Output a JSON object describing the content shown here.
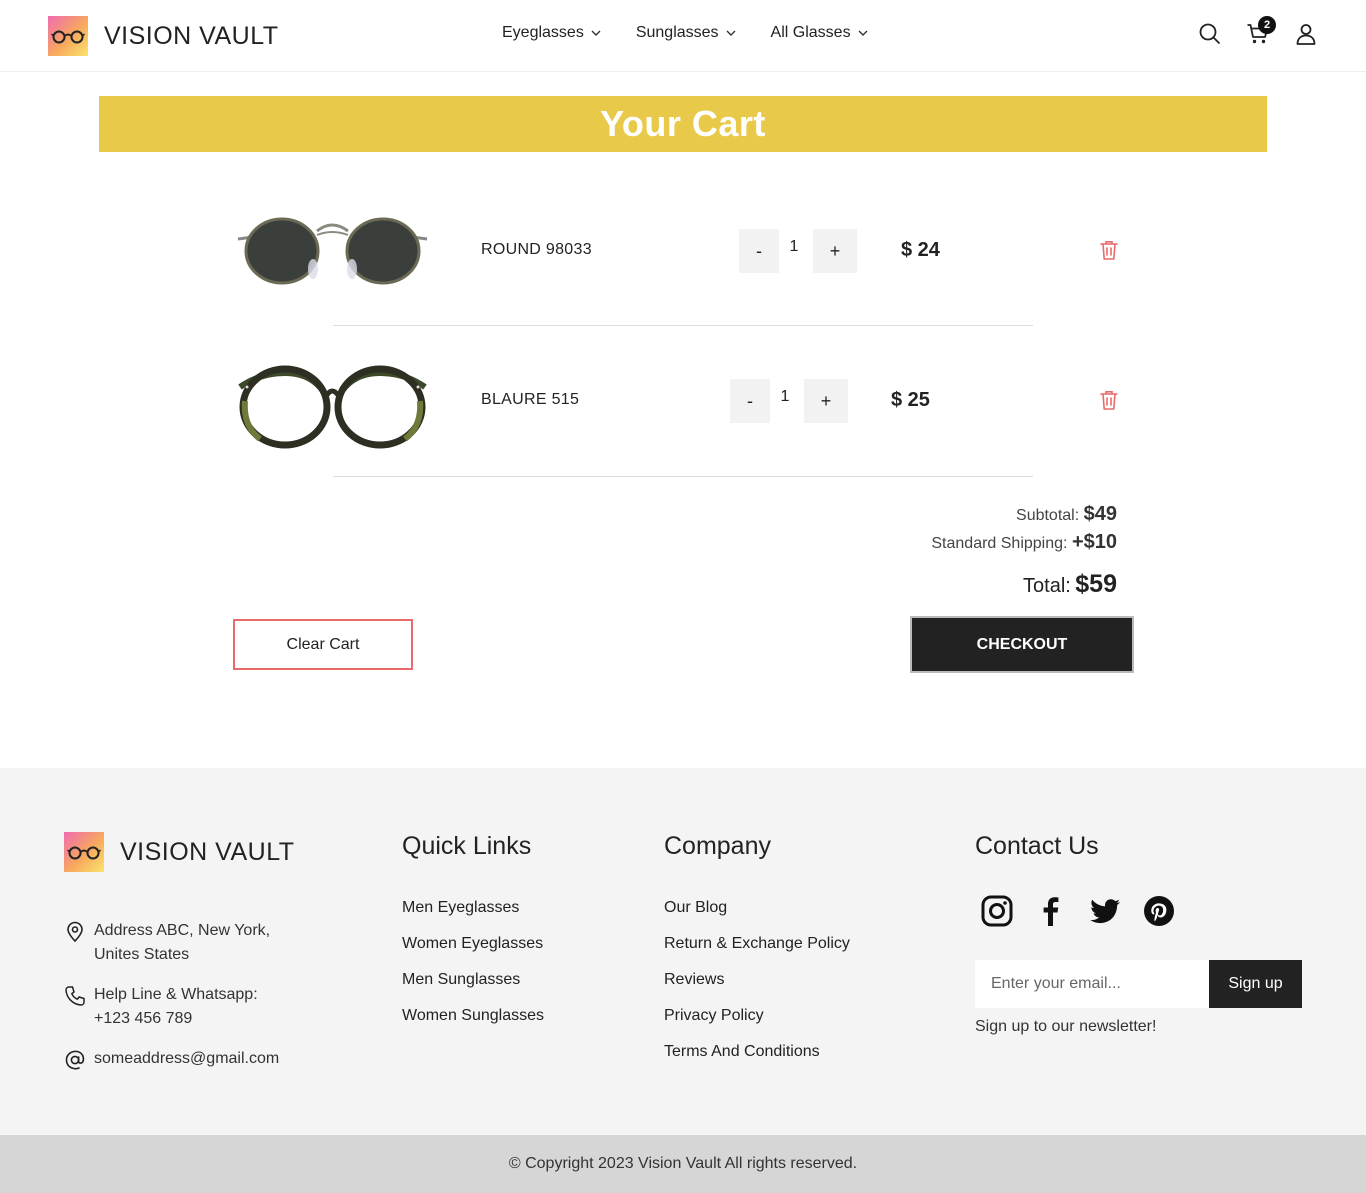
{
  "brand": {
    "name": "VISION VAULT"
  },
  "nav": {
    "items": [
      {
        "label": "Eyeglasses"
      },
      {
        "label": "Sunglasses"
      },
      {
        "label": "All Glasses"
      }
    ]
  },
  "header": {
    "cart_count": "2",
    "icons": [
      "search-icon",
      "cart-icon",
      "user-icon"
    ]
  },
  "page": {
    "title": "Your Cart"
  },
  "cart": {
    "items": [
      {
        "name": "ROUND 98033",
        "quantity": "1",
        "price": "$ 24",
        "decrement": "-",
        "increment": "+"
      },
      {
        "name": "BLAURE 515",
        "quantity": "1",
        "price": "$ 25",
        "decrement": "-",
        "increment": "+"
      }
    ],
    "subtotal_label": "Subtotal:",
    "subtotal": "$49",
    "shipping_label": "Standard Shipping:",
    "shipping": "+$10",
    "total_label": "Total:",
    "total": "$59",
    "clear_label": "Clear Cart",
    "checkout_label": "CHECKOUT"
  },
  "footer": {
    "address": "Address ABC, New York, Unites States",
    "address_line1": "Address ABC, New York,",
    "address_line2": "Unites States",
    "phone_line1": "Help Line & Whatsapp:",
    "phone_line2": "+123 456 789",
    "email": "someaddress@gmail.com",
    "quick_links": {
      "title": "Quick Links",
      "items": [
        "Men Eyeglasses",
        "Women Eyeglasses",
        "Men Sunglasses",
        "Women Sunglasses"
      ]
    },
    "company": {
      "title": "Company",
      "items": [
        "Our Blog",
        "Return & Exchange Policy",
        "Reviews",
        "Privacy Policy",
        "Terms And Conditions"
      ]
    },
    "contact": {
      "title": "Contact Us",
      "socials": [
        "instagram-icon",
        "facebook-icon",
        "twitter-icon",
        "pinterest-icon"
      ],
      "email_placeholder": "Enter your email...",
      "signup_label": "Sign up",
      "newsletter_note": "Sign up to our newsletter!"
    },
    "copyright": "© Copyright 2023 Vision Vault All rights reserved."
  },
  "colors": {
    "banner": "#e9c94a",
    "dark": "#222222",
    "danger": "#e86a6a",
    "footer_bg": "#f4f4f4"
  }
}
